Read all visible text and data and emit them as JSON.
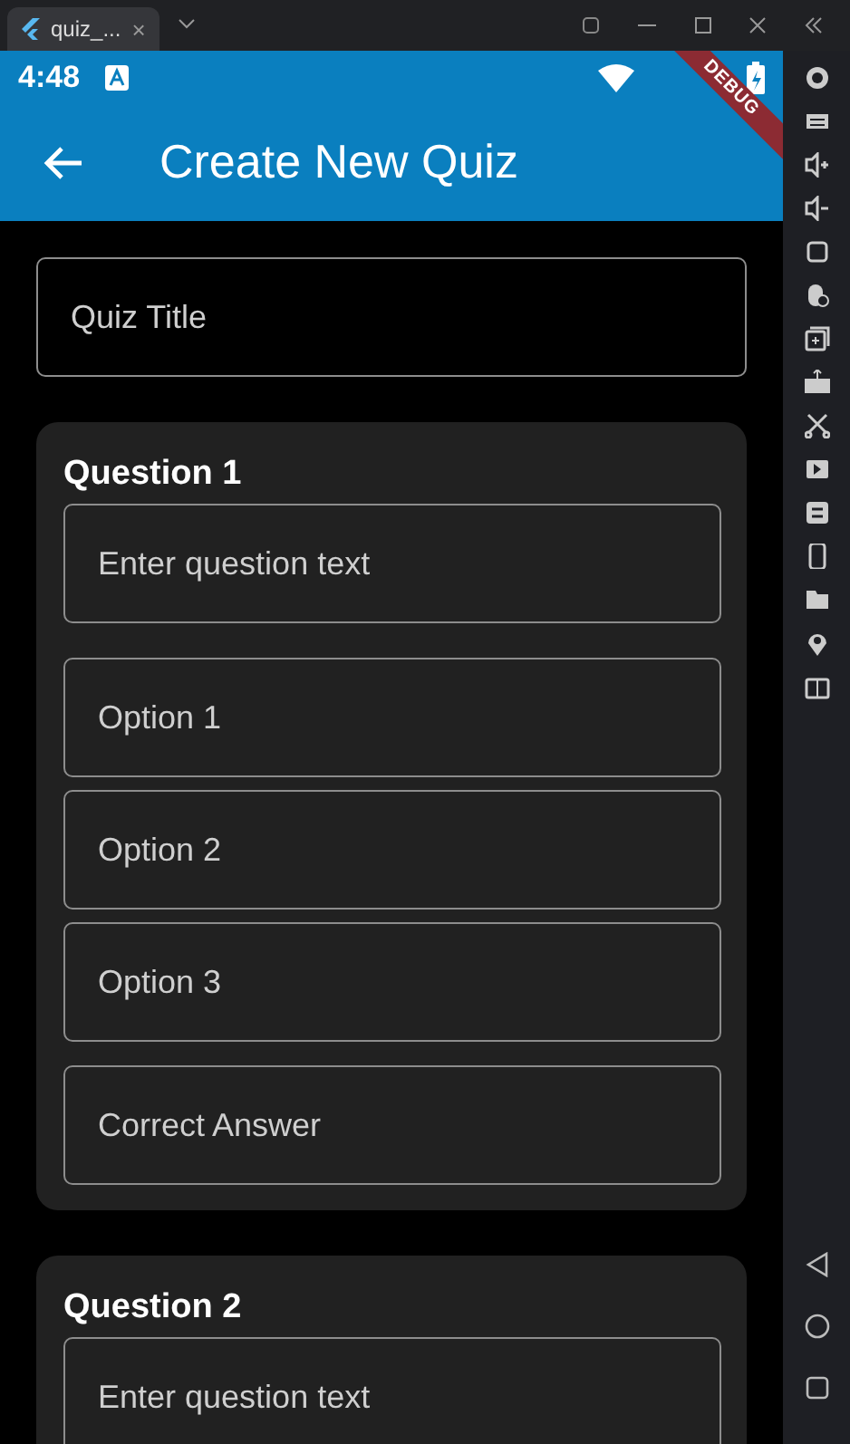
{
  "emulator": {
    "tab_title": "quiz_...",
    "tab_close": "×"
  },
  "status_bar": {
    "time": "4:48",
    "debug_banner": "DEBUG"
  },
  "app_bar": {
    "title": "Create New Quiz"
  },
  "quiz_title_field": {
    "placeholder": "Quiz Title"
  },
  "questions": [
    {
      "heading": "Question 1",
      "fields": [
        {
          "kind": "question",
          "placeholder": "Enter question text"
        },
        {
          "kind": "option",
          "placeholder": "Option 1"
        },
        {
          "kind": "option",
          "placeholder": "Option 2"
        },
        {
          "kind": "option",
          "placeholder": "Option 3"
        },
        {
          "kind": "answer",
          "placeholder": "Correct Answer"
        }
      ]
    },
    {
      "heading": "Question 2",
      "fields": [
        {
          "kind": "question",
          "placeholder": "Enter question text"
        }
      ]
    }
  ]
}
